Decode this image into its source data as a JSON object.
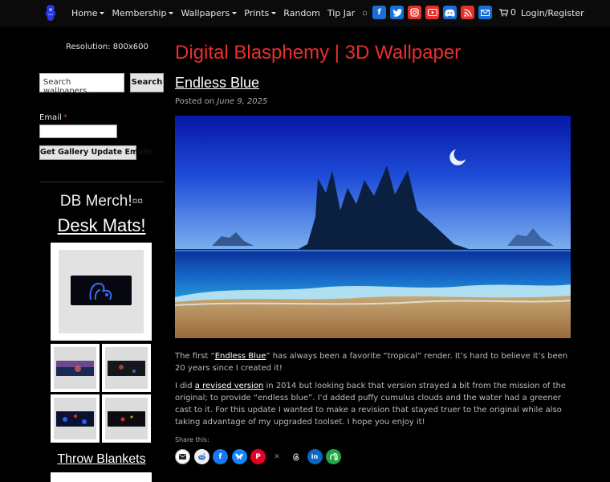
{
  "nav": {
    "menu": [
      {
        "label": "Home",
        "dropdown": true
      },
      {
        "label": "Membership",
        "dropdown": true
      },
      {
        "label": "Wallpapers",
        "dropdown": true
      },
      {
        "label": "Prints",
        "dropdown": true
      },
      {
        "label": "Random",
        "dropdown": false
      },
      {
        "label": "Tip Jar",
        "dropdown": false
      }
    ],
    "extra_glyph": "▫",
    "social_icons": [
      "facebook-icon",
      "twitter-icon",
      "instagram-icon",
      "youtube-icon",
      "discord-icon",
      "rss-icon",
      "email-icon"
    ],
    "cart_count": "0",
    "login_label": "Login/Register"
  },
  "sidebar": {
    "resolution": "Resolution: 800x600",
    "search_placeholder": "Search wallpapers…",
    "search_button": "Search",
    "email_label": "Email",
    "email_required": "*",
    "gallery_button": "Get Gallery Update Emails",
    "merch_title": "DB Merch!▫▫",
    "desk_mats": "Desk Mats!",
    "throw_blankets": "Throw Blankets"
  },
  "main": {
    "site_title": "Digital Blasphemy | 3D Wallpaper",
    "post_title": "Endless Blue",
    "posted_prefix": "Posted on",
    "posted_date": "June 9, 2025",
    "para1": {
      "before": "The first “",
      "link": "Endless Blue",
      "after": "” has always been a favorite “tropical” render.   It’s hard to believe it’s been 20 years since I created it!"
    },
    "para2": {
      "before": "I did ",
      "link": "a revised version",
      "after": " in 2014 but looking back that version strayed a bit from the mission of the original; to provide “endless blue”.    I’d added puffy cumulus clouds and the water had a greener cast to it.   For this update I wanted to make a revision that stayed truer to the original while also taking advantage of my upgraded toolset.   I hope you enjoy it!"
    },
    "share_label": "Share this:",
    "share_icons": [
      "email-share-icon",
      "reddit-share-icon",
      "facebook-share-icon",
      "bluesky-share-icon",
      "pinterest-share-icon",
      "x-share-icon",
      "threads-share-icon",
      "linkedin-share-icon",
      "nextdoor-share-icon"
    ]
  },
  "colors": {
    "accent_red": "#e8302b",
    "background": "#000000",
    "social_blue": "#1a6fd6",
    "social_red": "#e4322b"
  }
}
